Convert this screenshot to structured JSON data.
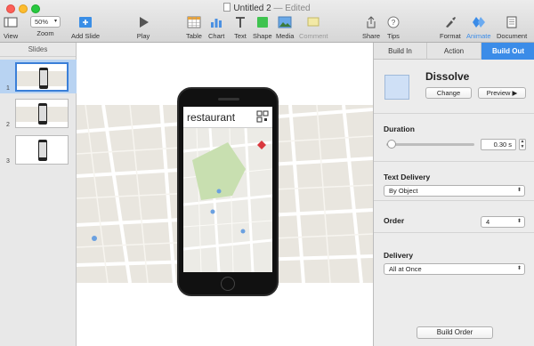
{
  "window": {
    "title": "Untitled 2",
    "status": "— Edited"
  },
  "toolbar": {
    "view_label": "View",
    "zoom_value": "50%",
    "zoom_label": "Zoom",
    "add_slide_label": "Add Slide",
    "play_label": "Play",
    "table_label": "Table",
    "chart_label": "Chart",
    "text_label": "Text",
    "shape_label": "Shape",
    "media_label": "Media",
    "comment_label": "Comment",
    "share_label": "Share",
    "tips_label": "Tips",
    "format_label": "Format",
    "animate_label": "Animate",
    "document_label": "Document"
  },
  "navigator": {
    "header": "Slides",
    "slides": [
      {
        "number": "1"
      },
      {
        "number": "2"
      },
      {
        "number": "3"
      }
    ]
  },
  "canvas": {
    "search_text": "restaurant"
  },
  "inspector": {
    "tabs": [
      "Build In",
      "Action",
      "Build Out"
    ],
    "effect_name": "Dissolve",
    "change_label": "Change",
    "preview_label": "Preview ▶",
    "duration_label": "Duration",
    "duration_value": "0.30 s",
    "text_delivery_label": "Text Delivery",
    "text_delivery_value": "By Object",
    "order_label": "Order",
    "order_value": "4",
    "delivery_label": "Delivery",
    "delivery_value": "All at Once",
    "build_order_label": "Build Order"
  },
  "colors": {
    "accent": "#3b8ce8",
    "selection": "#b8d3f2"
  }
}
